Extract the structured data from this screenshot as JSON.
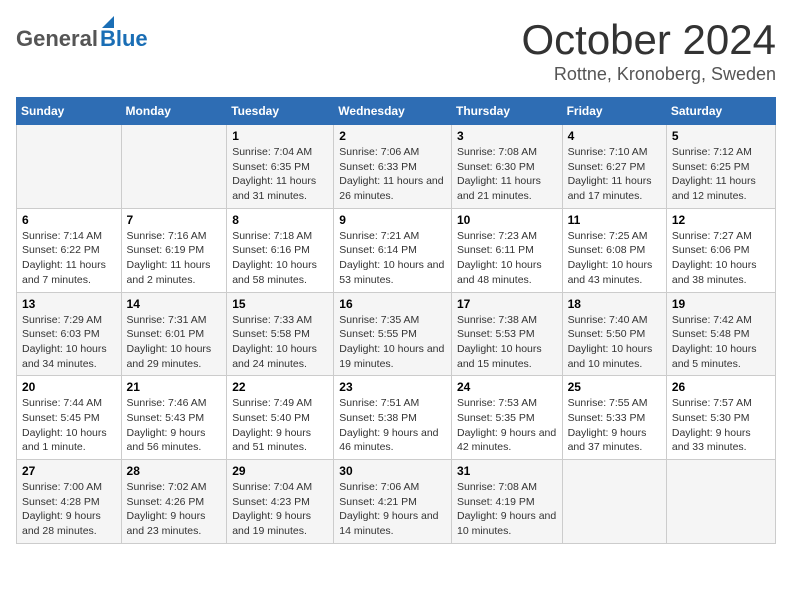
{
  "header": {
    "logo_general": "General",
    "logo_blue": "Blue",
    "month_title": "October 2024",
    "location": "Rottne, Kronoberg, Sweden"
  },
  "columns": [
    "Sunday",
    "Monday",
    "Tuesday",
    "Wednesday",
    "Thursday",
    "Friday",
    "Saturday"
  ],
  "weeks": [
    [
      {
        "num": "",
        "info": ""
      },
      {
        "num": "",
        "info": ""
      },
      {
        "num": "1",
        "info": "Sunrise: 7:04 AM\nSunset: 6:35 PM\nDaylight: 11 hours and 31 minutes."
      },
      {
        "num": "2",
        "info": "Sunrise: 7:06 AM\nSunset: 6:33 PM\nDaylight: 11 hours and 26 minutes."
      },
      {
        "num": "3",
        "info": "Sunrise: 7:08 AM\nSunset: 6:30 PM\nDaylight: 11 hours and 21 minutes."
      },
      {
        "num": "4",
        "info": "Sunrise: 7:10 AM\nSunset: 6:27 PM\nDaylight: 11 hours and 17 minutes."
      },
      {
        "num": "5",
        "info": "Sunrise: 7:12 AM\nSunset: 6:25 PM\nDaylight: 11 hours and 12 minutes."
      }
    ],
    [
      {
        "num": "6",
        "info": "Sunrise: 7:14 AM\nSunset: 6:22 PM\nDaylight: 11 hours and 7 minutes."
      },
      {
        "num": "7",
        "info": "Sunrise: 7:16 AM\nSunset: 6:19 PM\nDaylight: 11 hours and 2 minutes."
      },
      {
        "num": "8",
        "info": "Sunrise: 7:18 AM\nSunset: 6:16 PM\nDaylight: 10 hours and 58 minutes."
      },
      {
        "num": "9",
        "info": "Sunrise: 7:21 AM\nSunset: 6:14 PM\nDaylight: 10 hours and 53 minutes."
      },
      {
        "num": "10",
        "info": "Sunrise: 7:23 AM\nSunset: 6:11 PM\nDaylight: 10 hours and 48 minutes."
      },
      {
        "num": "11",
        "info": "Sunrise: 7:25 AM\nSunset: 6:08 PM\nDaylight: 10 hours and 43 minutes."
      },
      {
        "num": "12",
        "info": "Sunrise: 7:27 AM\nSunset: 6:06 PM\nDaylight: 10 hours and 38 minutes."
      }
    ],
    [
      {
        "num": "13",
        "info": "Sunrise: 7:29 AM\nSunset: 6:03 PM\nDaylight: 10 hours and 34 minutes."
      },
      {
        "num": "14",
        "info": "Sunrise: 7:31 AM\nSunset: 6:01 PM\nDaylight: 10 hours and 29 minutes."
      },
      {
        "num": "15",
        "info": "Sunrise: 7:33 AM\nSunset: 5:58 PM\nDaylight: 10 hours and 24 minutes."
      },
      {
        "num": "16",
        "info": "Sunrise: 7:35 AM\nSunset: 5:55 PM\nDaylight: 10 hours and 19 minutes."
      },
      {
        "num": "17",
        "info": "Sunrise: 7:38 AM\nSunset: 5:53 PM\nDaylight: 10 hours and 15 minutes."
      },
      {
        "num": "18",
        "info": "Sunrise: 7:40 AM\nSunset: 5:50 PM\nDaylight: 10 hours and 10 minutes."
      },
      {
        "num": "19",
        "info": "Sunrise: 7:42 AM\nSunset: 5:48 PM\nDaylight: 10 hours and 5 minutes."
      }
    ],
    [
      {
        "num": "20",
        "info": "Sunrise: 7:44 AM\nSunset: 5:45 PM\nDaylight: 10 hours and 1 minute."
      },
      {
        "num": "21",
        "info": "Sunrise: 7:46 AM\nSunset: 5:43 PM\nDaylight: 9 hours and 56 minutes."
      },
      {
        "num": "22",
        "info": "Sunrise: 7:49 AM\nSunset: 5:40 PM\nDaylight: 9 hours and 51 minutes."
      },
      {
        "num": "23",
        "info": "Sunrise: 7:51 AM\nSunset: 5:38 PM\nDaylight: 9 hours and 46 minutes."
      },
      {
        "num": "24",
        "info": "Sunrise: 7:53 AM\nSunset: 5:35 PM\nDaylight: 9 hours and 42 minutes."
      },
      {
        "num": "25",
        "info": "Sunrise: 7:55 AM\nSunset: 5:33 PM\nDaylight: 9 hours and 37 minutes."
      },
      {
        "num": "26",
        "info": "Sunrise: 7:57 AM\nSunset: 5:30 PM\nDaylight: 9 hours and 33 minutes."
      }
    ],
    [
      {
        "num": "27",
        "info": "Sunrise: 7:00 AM\nSunset: 4:28 PM\nDaylight: 9 hours and 28 minutes."
      },
      {
        "num": "28",
        "info": "Sunrise: 7:02 AM\nSunset: 4:26 PM\nDaylight: 9 hours and 23 minutes."
      },
      {
        "num": "29",
        "info": "Sunrise: 7:04 AM\nSunset: 4:23 PM\nDaylight: 9 hours and 19 minutes."
      },
      {
        "num": "30",
        "info": "Sunrise: 7:06 AM\nSunset: 4:21 PM\nDaylight: 9 hours and 14 minutes."
      },
      {
        "num": "31",
        "info": "Sunrise: 7:08 AM\nSunset: 4:19 PM\nDaylight: 9 hours and 10 minutes."
      },
      {
        "num": "",
        "info": ""
      },
      {
        "num": "",
        "info": ""
      }
    ]
  ]
}
